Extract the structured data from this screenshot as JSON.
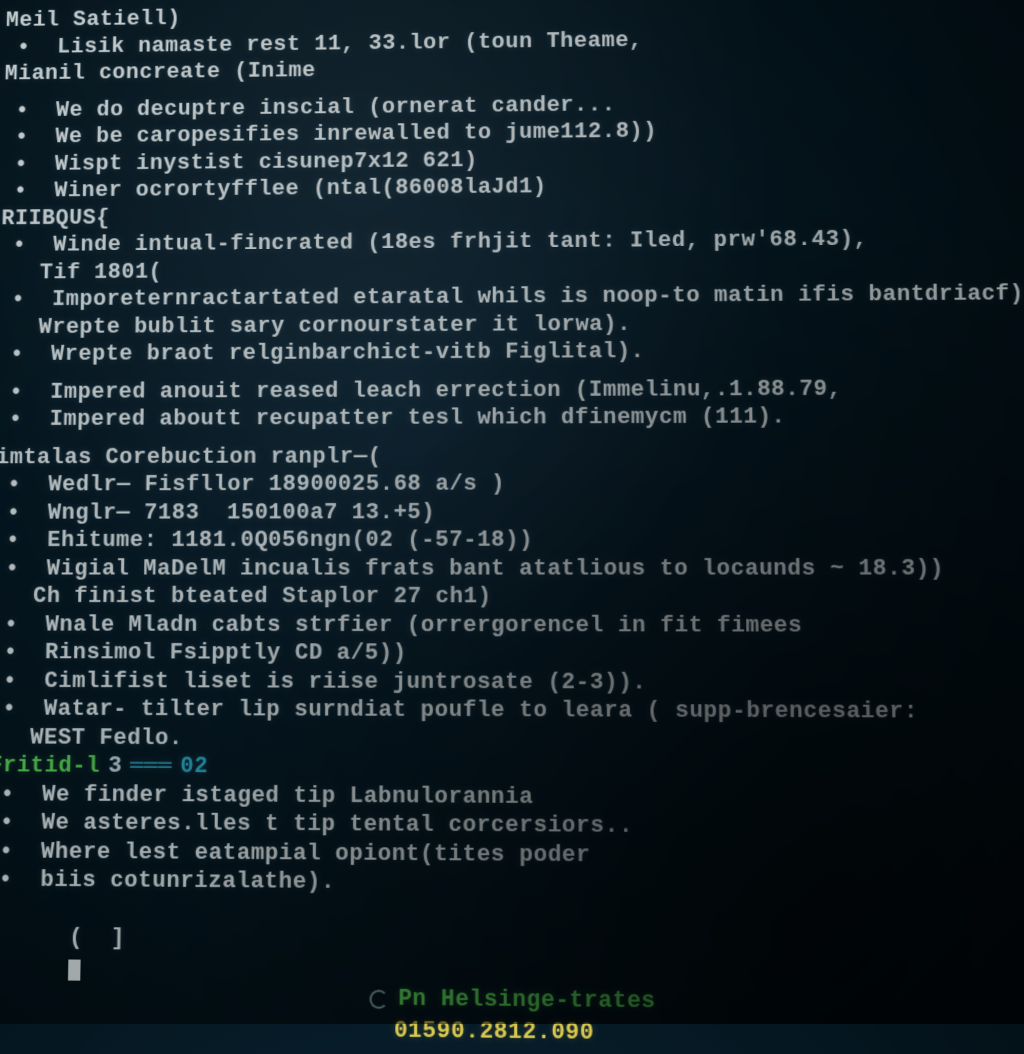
{
  "header": {
    "line1": "Meil Satiell)",
    "line2_bullet": "Lisik namaste rest 11, 33.lor (toun Theame,",
    "line3": "Mianil concreate (Inime"
  },
  "block1": [
    "We do decuptre inscial (ornerat cander...",
    "We be caropesifies inrewalled to jume112.8))",
    "Wispt inystist cisunep7x12 621)",
    "Winer ocrortyfflee (ntal(86008laJd1)"
  ],
  "section1_label": "RIIBQUS{",
  "block2": [
    "Winde intual-fincrated (18es frhjit tant: Iled, prw'68.43),",
    "Tif 1801(",
    "Imporeternractartated etaratal whils is noop-to matin ifis bantdriacf)",
    "Wrepte bublit sary cornourstater it lorwa).",
    "Wrepte braot relginbarchict-vitb Figlital)."
  ],
  "block3": [
    "Impered anouit reased leach errection (Immelinu,.1.88.79,",
    "Impered aboutt recupatter tesl which dfinemycm (111)."
  ],
  "section2_label": "imtalas Corebuction ranplr—(",
  "block4": [
    "Wedlr— Fisfllor 18900025.68 a/s )",
    "Wnglr— 7183  150100a7 13.+5)",
    "Ehitume: 1181.0Q056ngn(02 (-57-18))",
    "Wigial MaDelM incualis frats bant atatlious to locaunds ~ 18.3))",
    "Ch finist bteated Staplor 27 ch1)",
    "Wnale Mladn cabts strfier (orrergorencel in fit fimees",
    "Rinsimol Fsipptly CD a/5))",
    "Cimlifist liset is riise juntrosate (2-3)).",
    "Watar- tilter lip surndiat poufle to leara ( supp-brencesaier:",
    "WEST Fedlo."
  ],
  "prompt": {
    "label": "Fritid-l",
    "num": "3",
    "sep": "═══",
    "val": "02"
  },
  "block5": [
    "We finder istaged tip Labnulorannia",
    "We asteres.lles t tip tental corcersiors..",
    "Where lest eatampial opiont(tites poder",
    "biis cotunrizalathe)."
  ],
  "prompt2": "(  ]",
  "footer": {
    "text": "Pn Helsinge-trates",
    "num": "01590.2812.090"
  }
}
